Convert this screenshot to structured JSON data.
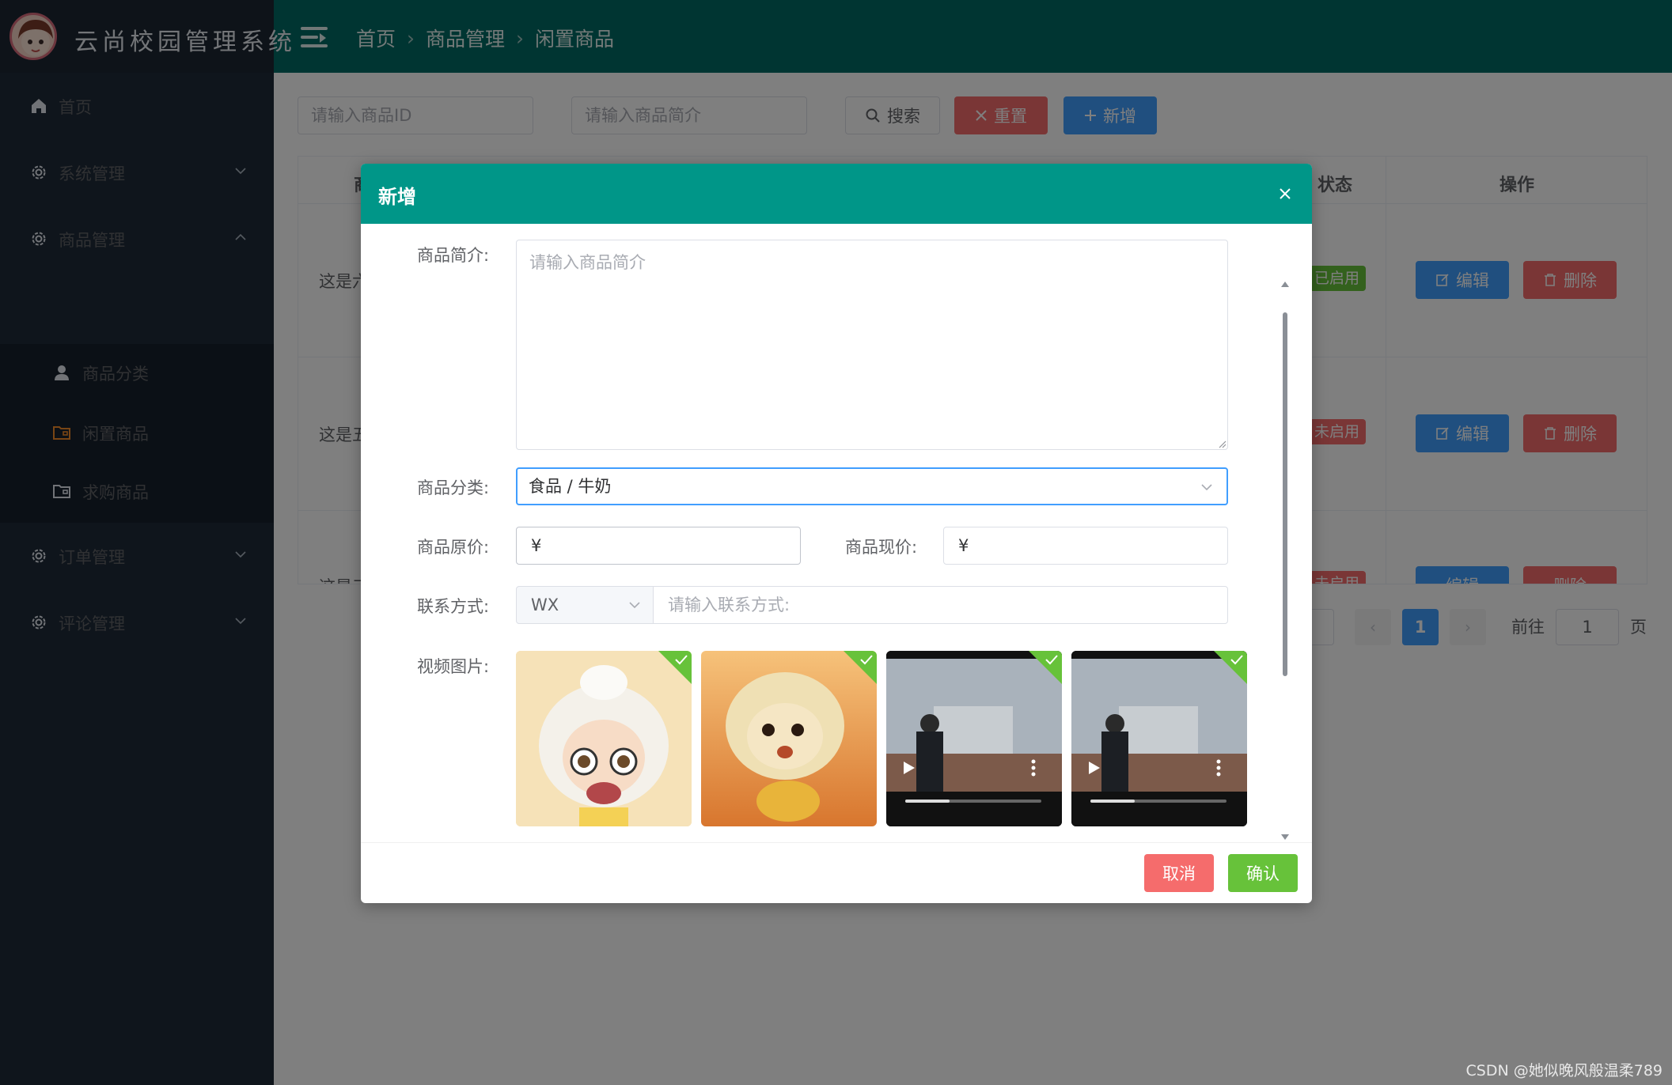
{
  "app": {
    "title": "云尚校园管理系统"
  },
  "breadcrumb": [
    "首页",
    "商品管理",
    "闲置商品"
  ],
  "sidebar": {
    "items": [
      {
        "label": "首页",
        "icon": "home-icon"
      },
      {
        "label": "系统管理",
        "icon": "gear-icon"
      },
      {
        "label": "商品管理",
        "icon": "gear-icon"
      },
      {
        "label": "订单管理",
        "icon": "gear-icon"
      },
      {
        "label": "评论管理",
        "icon": "gear-icon"
      }
    ],
    "sub_items": [
      {
        "label": "商品分类",
        "icon": "user-icon"
      },
      {
        "label": "闲置商品",
        "icon": "folder-icon",
        "active": true
      },
      {
        "label": "求购商品",
        "icon": "folder-icon"
      }
    ]
  },
  "search": {
    "id_placeholder": "请输入商品ID",
    "intro_placeholder": "请输入商品简介",
    "search_label": "搜索",
    "reset_label": "重置",
    "add_label": "新增"
  },
  "table": {
    "headers": {
      "status": "状态",
      "actions": "操作",
      "first_partial": "商"
    },
    "rows": [
      {
        "text": "这是六",
        "status": "已启用",
        "status_color": "#67c23a"
      },
      {
        "text": "这是五",
        "status": "未启用",
        "status_color": "#f56c6c"
      },
      {
        "text": "这是三",
        "status": "未启用",
        "status_color": "#f56c6c"
      }
    ],
    "edit_label": "编辑",
    "delete_label": "删除"
  },
  "pagination": {
    "current": "1",
    "goto_label": "前往",
    "goto_value": "1",
    "page_suffix": "页"
  },
  "dialog": {
    "title": "新增",
    "intro_label": "商品简介:",
    "intro_placeholder": "请输入商品简介",
    "category_label": "商品分类:",
    "category_value": "食品 / 牛奶",
    "original_price_label": "商品原价:",
    "original_price_prefix": "¥",
    "current_price_label": "商品现价:",
    "current_price_prefix": "¥",
    "contact_label": "联系方式:",
    "contact_type": "WX",
    "contact_placeholder": "请输入联系方式:",
    "media_label": "视频图片:",
    "cancel_label": "取消",
    "confirm_label": "确认"
  },
  "colors": {
    "header_teal": "#006a64",
    "dialog_teal": "#009688",
    "sidebar_bg": "#1f2b38",
    "active_orange": "#f08a2a",
    "primary_blue": "#409eff",
    "danger_red": "#f56c6c",
    "success_green": "#67c23a"
  },
  "watermark": "CSDN @她似晚风般温柔789"
}
